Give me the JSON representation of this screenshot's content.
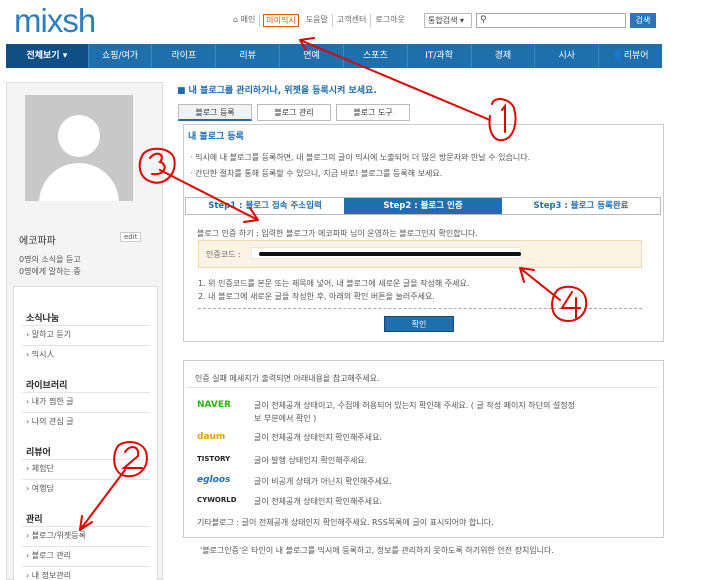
{
  "header": {
    "logo": "mixsh",
    "links": [
      "메인",
      "마이믹시",
      "도움말",
      "고객센터",
      "로그아웃"
    ],
    "search_select": "통합검색",
    "search_button": "검색"
  },
  "nav": [
    "전체보기 ▾",
    "쇼핑/여가",
    "라이프",
    "리뷰",
    "연예",
    "스포츠",
    "IT/과학",
    "경제",
    "시사",
    "리뷰어"
  ],
  "sidebar": {
    "username": "에코파파",
    "edit_label": "edit",
    "stat1": "0명의 소식을 듣고",
    "stat2": "0명에게 말하는 중",
    "groups": [
      {
        "title": "소식나눔",
        "items": [
          "말하고 듣기",
          "믹시人"
        ]
      },
      {
        "title": "라이브러리",
        "items": [
          "내가 찜한 글",
          "나의 관심 글"
        ]
      },
      {
        "title": "리뷰어",
        "items": [
          "체험단",
          "여행담"
        ]
      },
      {
        "title": "관리",
        "items": [
          "블로그/위젯등록",
          "블로그 관리",
          "내 정보관리"
        ]
      }
    ]
  },
  "main": {
    "headline": "내 블로그를 관리하거나, 위젯을 등록시켜 보세요.",
    "tabs": [
      "블로그 등록",
      "블로그 관리",
      "블로그 도구"
    ],
    "panel_title": "내 블로그 등록",
    "desc1": "· 믹시에 내 블로그를 등록하면, 내 블로그의 글이 믹시에 노출되어 더 많은 방문자와 만날 수 있습니다.",
    "desc2": "· 간단한 절차를 통해 등록할 수 있으니, 지금 바로! 블로그를 등록해 보세요.",
    "steps": [
      "Step1 : 블로그 접속 주소입력",
      "Step2 : 블로그 인증",
      "Step3 : 블로그 등록완료"
    ],
    "verify_desc": "블로그 인증 하기 : 입력한 블로그가 에코파파 님이 운영하는 블로그인지 확인합니다.",
    "code_label": "인증코드 :",
    "note1": "1. 위 인증코드를 본문 또는 제목에 넣어, 내 블로그에 새로운 글을 작성해 주세요.",
    "note2": "2. 내 블로그에 새로운 글을 작성한 후, 아래의 확인 버튼을 눌러주세요.",
    "confirm_button": "확인",
    "fail_title": "인증 실패 메세지가 출력되면 아래내용을 참고해주세요.",
    "services": [
      {
        "name": "NAVER",
        "color": "#2db400",
        "text": "글이 전체공개 상태이고, 수집에 허용되어 있는지 확인해 주세요. ( 글 작성 페이지 하단의 설정정"
      },
      {
        "name": "daum",
        "color": "#e8a000",
        "text": "글이 전체공개 상태인지 확인해주세요."
      },
      {
        "name": "TISTORY",
        "color": "#222222",
        "text": "글이 발행 상태인지 확인해주세요."
      },
      {
        "name": "egloos",
        "color": "#1b6fb3",
        "text": "글이 비공개 상태가 아닌지 확인해주세요."
      },
      {
        "name": "CYWORLD",
        "color": "#222222",
        "text": "글이 전체공개 상태인지 확인해주세요."
      }
    ],
    "naver_extra": "보 부분에서 확인 )",
    "etc_line": "기타블로그 : 글이 전체공개 상태인지 확인해주세요. RSS목록에 글이 표시되어야 합니다.",
    "footer": "'블로그인증'은 타인이 내 블로그를 믹시에 등록하고, 정보를 관리하지 못하도록 하기위한 안전 장치입니다."
  }
}
